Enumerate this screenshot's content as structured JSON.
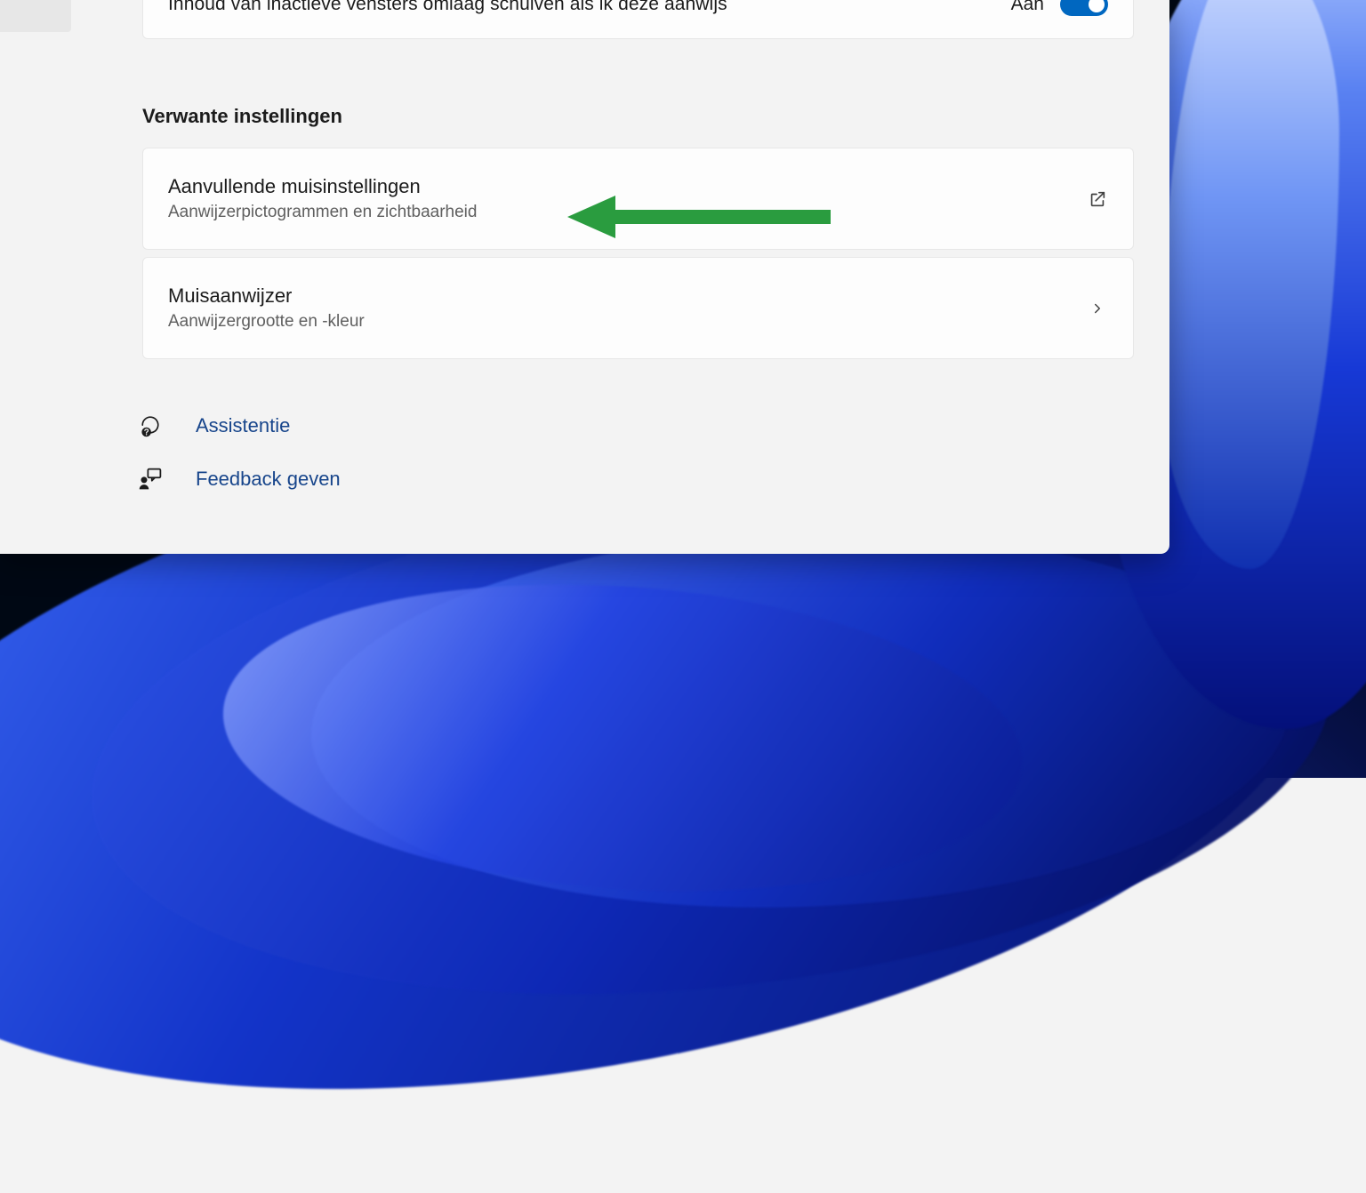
{
  "top_row": {
    "title": "Inhoud van inactieve vensters omlaag schuiven als ik deze aanwijs",
    "toggle_state_label": "Aan",
    "toggle_on": true
  },
  "section_header": "Verwante instellingen",
  "cards": [
    {
      "title": "Aanvullende muisinstellingen",
      "sub": "Aanwijzerpictogrammen en zichtbaarheid",
      "action": "external"
    },
    {
      "title": "Muisaanwijzer",
      "sub": "Aanwijzergrootte en -kleur",
      "action": "navigate"
    }
  ],
  "helper_links": [
    {
      "label": "Assistentie",
      "icon": "help"
    },
    {
      "label": "Feedback geven",
      "icon": "feedback"
    }
  ]
}
